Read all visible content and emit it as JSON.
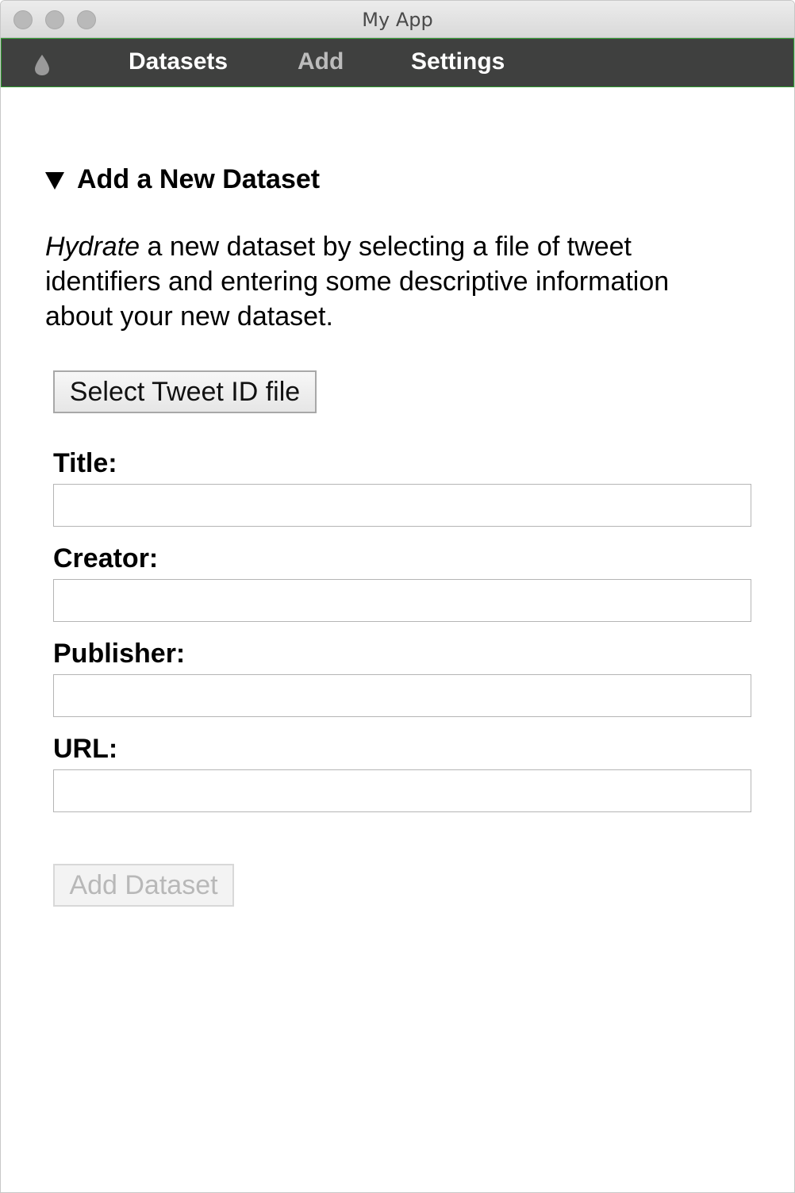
{
  "window": {
    "title": "My App"
  },
  "nav": {
    "logo_icon": "water-drop-icon",
    "items": [
      {
        "label": "Datasets"
      },
      {
        "label": "Add"
      },
      {
        "label": "Settings"
      }
    ],
    "active": "Add",
    "background_color": "#3f403f",
    "border_color": "#2f9b2f"
  },
  "section": {
    "heading": "Add a New Dataset",
    "disclosure_icon": "triangle-down-icon",
    "description_emphasis": "Hydrate",
    "description_rest": " a new dataset by selecting a file of tweet identifiers and entering some descriptive information about your new dataset."
  },
  "form": {
    "select_file_label": "Select Tweet ID file",
    "fields": [
      {
        "label": "Title:",
        "value": ""
      },
      {
        "label": "Creator:",
        "value": ""
      },
      {
        "label": "Publisher:",
        "value": ""
      },
      {
        "label": "URL:",
        "value": ""
      }
    ],
    "submit_label": "Add Dataset",
    "submit_disabled": true
  }
}
